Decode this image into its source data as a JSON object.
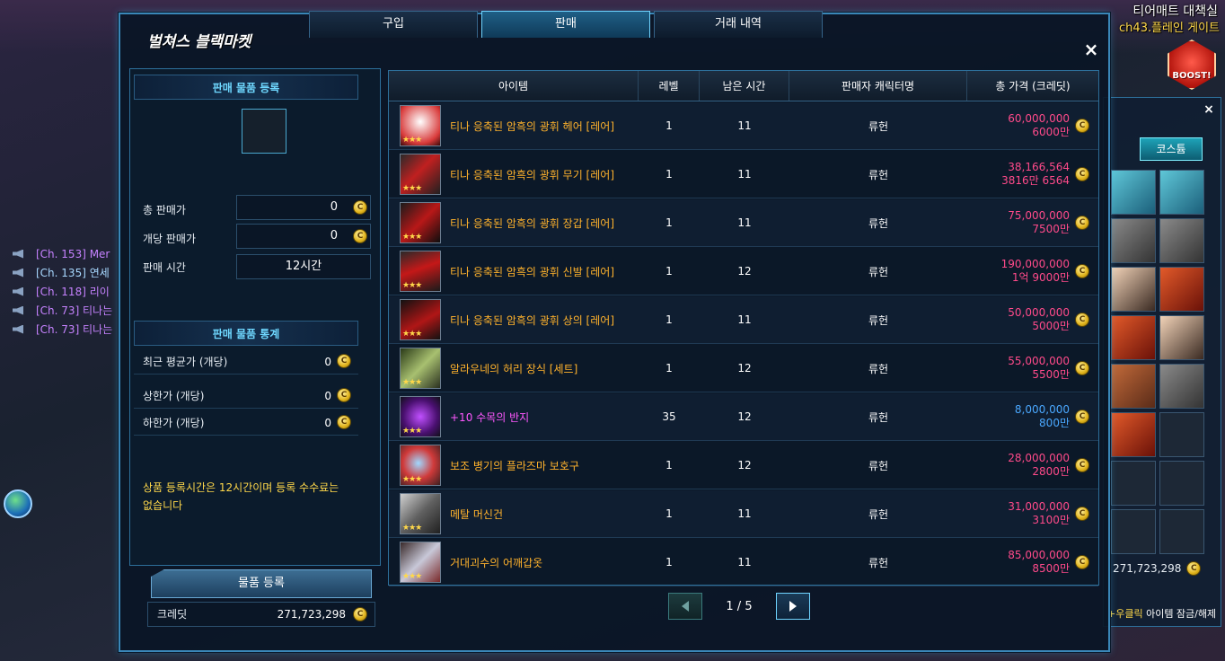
{
  "scene": {
    "zone_title": "티어매트 대책실",
    "zone_channel": "ch43.플레인 게이트",
    "boost_label": "BOOST!"
  },
  "chat": [
    {
      "text": "[Ch. 153] Mer"
    },
    {
      "text": "[Ch. 135] 연세"
    },
    {
      "text": "[Ch. 118] 리이"
    },
    {
      "text": "[Ch. 73] 티나는"
    },
    {
      "text": "[Ch. 73] 티나는"
    }
  ],
  "inventory": {
    "close": "×",
    "tab_costume": "코스튬",
    "credits": "271,723,298",
    "hint_key": "+우클릭",
    "hint_text": "아이템 잠금/해제"
  },
  "window": {
    "title": "벌쳐스 블랙마켓",
    "close": "×",
    "tabs": [
      "구입",
      "판매",
      "거래 내역"
    ],
    "active_tab": 1
  },
  "sell_form": {
    "section_title": "판매 물품 등록",
    "total_price_label": "총 판매가",
    "total_price_value": "0",
    "unit_price_label": "개당 판매가",
    "unit_price_value": "0",
    "duration_label": "판매 시간",
    "duration_value": "12시간"
  },
  "stats": {
    "section_title": "판매 물품 통계",
    "recent_avg_label": "최근 평균가 (개당)",
    "recent_avg_value": "0",
    "upper_label": "상한가 (개당)",
    "upper_value": "0",
    "lower_label": "하한가 (개당)",
    "lower_value": "0"
  },
  "notice": "상품 등록시간은 12시간이며 등록 수수료는 없습니다",
  "register_button": "물품 등록",
  "credit": {
    "label": "크레딧",
    "value": "271,723,298"
  },
  "table": {
    "headers": [
      "아이템",
      "레벨",
      "남은 시간",
      "판매자 캐릭터명",
      "총 가격 (크레딧)"
    ],
    "rows": [
      {
        "icon": "hair-icon",
        "name": "티나 응축된 암흑의 광휘 헤어 [레어]",
        "level": "1",
        "time": "11",
        "seller": "류헌",
        "price": "60,000,000",
        "price_short": "6000만"
      },
      {
        "icon": "weapon-icon",
        "name": "티나 응축된 암흑의 광휘 무기 [레어]",
        "level": "1",
        "time": "11",
        "seller": "류헌",
        "price": "38,166,564",
        "price_short": "3816만 6564"
      },
      {
        "icon": "glove-icon",
        "name": "티나 응축된 암흑의 광휘 장갑 [레어]",
        "level": "1",
        "time": "11",
        "seller": "류헌",
        "price": "75,000,000",
        "price_short": "7500만"
      },
      {
        "icon": "shoes-icon",
        "name": "티나 응축된 암흑의 광휘 신발 [레어]",
        "level": "1",
        "time": "12",
        "seller": "류헌",
        "price": "190,000,000",
        "price_short": "1억 9000만"
      },
      {
        "icon": "top-icon",
        "name": "티나 응축된 암흑의 광휘 상의 [레어]",
        "level": "1",
        "time": "11",
        "seller": "류헌",
        "price": "50,000,000",
        "price_short": "5000만"
      },
      {
        "icon": "wing-icon",
        "name": "알라우네의 허리 장식 [세트]",
        "level": "1",
        "time": "12",
        "seller": "류헌",
        "price": "55,000,000",
        "price_short": "5500만"
      },
      {
        "icon": "ring-icon",
        "name": "+10 수목의 반지",
        "level": "35",
        "time": "12",
        "seller": "류헌",
        "price": "8,000,000",
        "price_short": "800만"
      },
      {
        "icon": "armguard-icon",
        "name": "보조 병기의 플라즈마 보호구",
        "level": "1",
        "time": "12",
        "seller": "류헌",
        "price": "28,000,000",
        "price_short": "2800만"
      },
      {
        "icon": "gun-icon",
        "name": "메탈 머신건",
        "level": "1",
        "time": "11",
        "seller": "류헌",
        "price": "31,000,000",
        "price_short": "3100만"
      },
      {
        "icon": "shoulder-icon",
        "name": "거대괴수의 어깨갑옷",
        "level": "1",
        "time": "11",
        "seller": "류헌",
        "price": "85,000,000",
        "price_short": "8500만"
      }
    ]
  },
  "pager": {
    "text": "1 / 5"
  },
  "colors": {
    "name_orange": "#ffb22c",
    "name_magenta": "#ff58ff",
    "price_pink": "#ff4a8a",
    "price_blue": "#4aa8ff",
    "accent": "#6fd8ff",
    "notice": "#ffd84a"
  }
}
